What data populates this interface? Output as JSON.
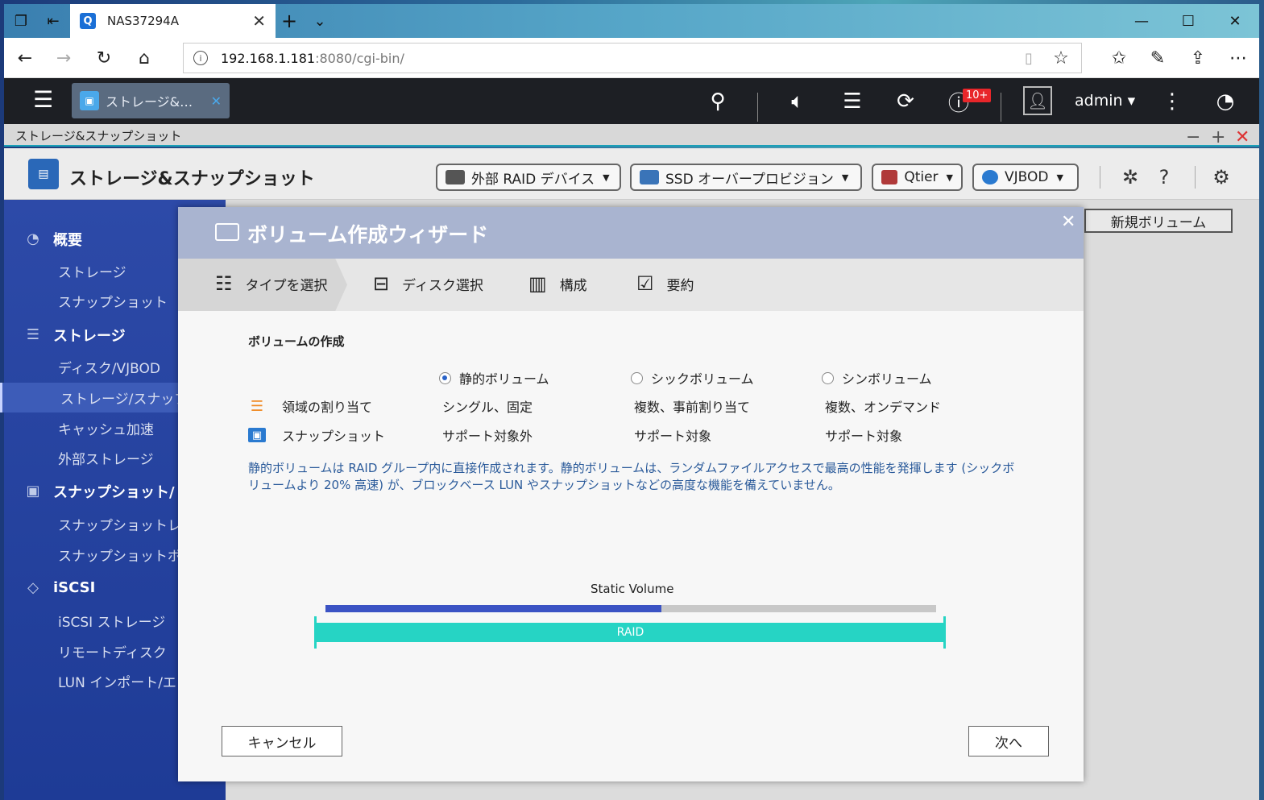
{
  "browser": {
    "tab_title": "NAS37294A",
    "tab_favicon": "Q",
    "url_host": "192.168.1.181",
    "url_rest": ":8080/cgi-bin/"
  },
  "qts": {
    "app_tab_label": "ストレージ&…",
    "badge": "10+",
    "user": "admin ▾"
  },
  "window": {
    "title": "ストレージ&スナップショット"
  },
  "app": {
    "title": "ストレージ&スナップショット",
    "pills": [
      {
        "label": "外部 RAID デバイス",
        "icon": "raid-icon"
      },
      {
        "label": "SSD オーバープロビジョン",
        "icon": "ssd-icon"
      },
      {
        "label": "Qtier",
        "icon": "qtier-icon"
      },
      {
        "label": "VJBOD",
        "icon": "vjbod-icon"
      }
    ],
    "new_volume": "新規ボリューム"
  },
  "sidebar": {
    "items": [
      {
        "label": "概要",
        "type": "head",
        "icon": "gauge-icon"
      },
      {
        "label": "ストレージ",
        "type": "sub"
      },
      {
        "label": "スナップショット",
        "type": "sub"
      },
      {
        "label": "ストレージ",
        "type": "head",
        "icon": "database-icon"
      },
      {
        "label": "ディスク/VJBOD",
        "type": "sub"
      },
      {
        "label": "ストレージ/スナップ",
        "type": "sub",
        "selected": true
      },
      {
        "label": "キャッシュ加速",
        "type": "sub"
      },
      {
        "label": "外部ストレージ",
        "type": "sub"
      },
      {
        "label": "スナップショット/",
        "type": "head",
        "icon": "camera-icon"
      },
      {
        "label": "スナップショットレ",
        "type": "sub"
      },
      {
        "label": "スナップショットボ",
        "type": "sub"
      },
      {
        "label": "iSCSI",
        "type": "head",
        "icon": "iscsi-icon"
      },
      {
        "label": "iSCSI ストレージ",
        "type": "sub"
      },
      {
        "label": "リモートディスク",
        "type": "sub"
      },
      {
        "label": "LUN インポート/エ",
        "type": "sub"
      }
    ]
  },
  "wizard": {
    "title": "ボリューム作成ウィザード",
    "steps": [
      {
        "label": "タイプを選択",
        "icon": "list-icon"
      },
      {
        "label": "ディスク選択",
        "icon": "disk-icon"
      },
      {
        "label": "構成",
        "icon": "config-icon"
      },
      {
        "label": "要約",
        "icon": "clipboard-icon"
      }
    ],
    "section_title": "ボリュームの作成",
    "options": [
      {
        "label": "静的ボリューム",
        "selected": true
      },
      {
        "label": "シックボリューム",
        "selected": false
      },
      {
        "label": "シンボリューム",
        "selected": false
      }
    ],
    "rows": [
      {
        "label": "領域の割り当て",
        "icon": "allocation-icon",
        "values": [
          "シングル、固定",
          "複数、事前割り当て",
          "複数、オンデマンド"
        ]
      },
      {
        "label": "スナップショット",
        "icon": "snapshot-icon",
        "values": [
          "サポート対象外",
          "サポート対象",
          "サポート対象"
        ]
      }
    ],
    "description": "静的ボリュームは RAID グループ内に直接作成されます。静的ボリュームは、ランダムファイルアクセスで最高の性能を発揮します (シックボリュームより 20% 高速) が、ブロックベース LUN やスナップショットなどの高度な機能を備えていません。",
    "diagram": {
      "volume_label": "Static Volume",
      "volume_fill_fraction": 0.55,
      "raid_label": "RAID"
    },
    "cancel": "キャンセル",
    "next": "次へ"
  },
  "colors": {
    "accent": "#2a63c8",
    "raid": "#26d4c4",
    "volume_fill": "#3b53c4",
    "description_text": "#2a5a9a"
  }
}
